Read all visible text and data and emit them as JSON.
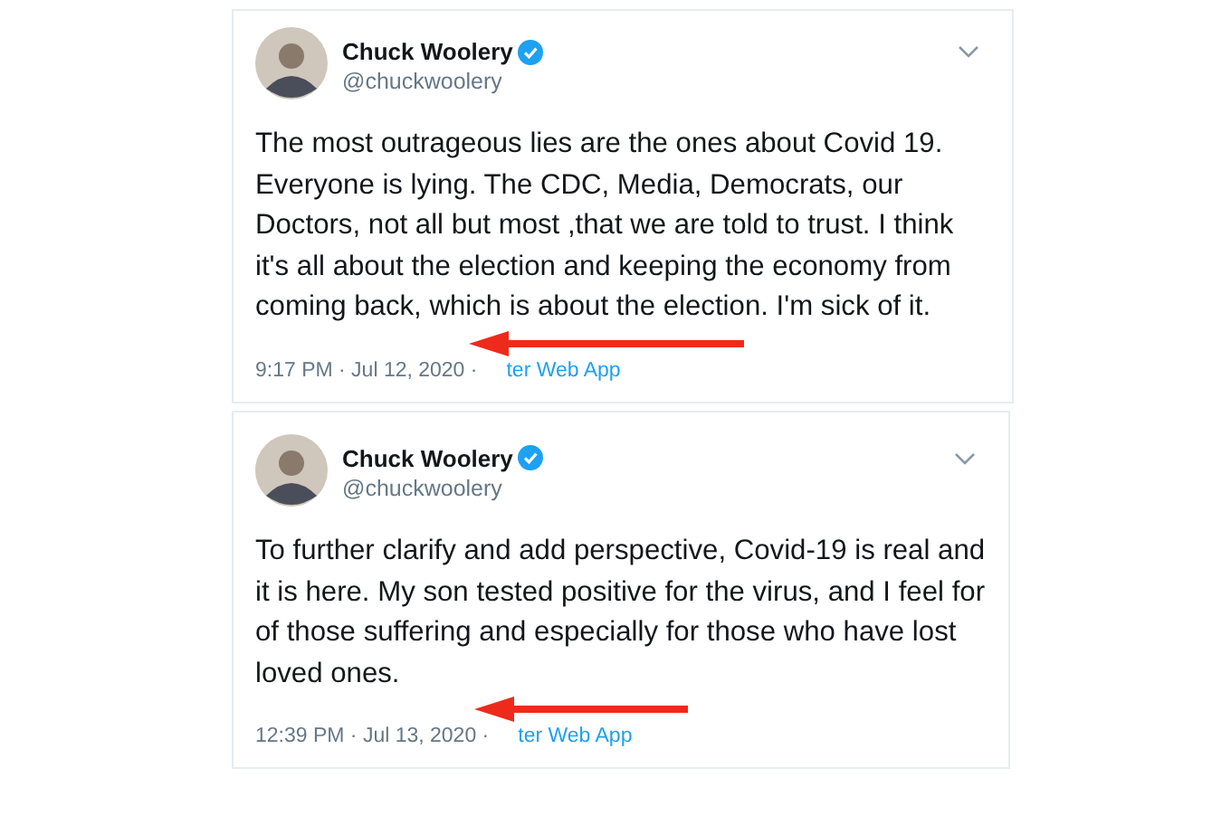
{
  "tweets": [
    {
      "name": "Chuck Woolery",
      "handle": "@chuckwoolery",
      "verified": true,
      "text": "The most outrageous lies are the ones about Covid 19. Everyone is lying. The CDC, Media, Democrats, our Doctors, not all but most ,that we are told to trust. I think it's all about the election and keeping the economy from coming back, which is about the election. I'm sick of it.",
      "time": "9:17 PM · Jul 12, 2020 ·",
      "source": "ter Web App"
    },
    {
      "name": "Chuck Woolery",
      "handle": "@chuckwoolery",
      "verified": true,
      "text": "To further clarify and add perspective, Covid-19 is real and it is here. My son tested positive for the virus, and I feel for of those suffering and especially for those who have lost loved ones.",
      "time": "12:39 PM · Jul 13, 2020 ·",
      "source": "ter Web App"
    }
  ]
}
